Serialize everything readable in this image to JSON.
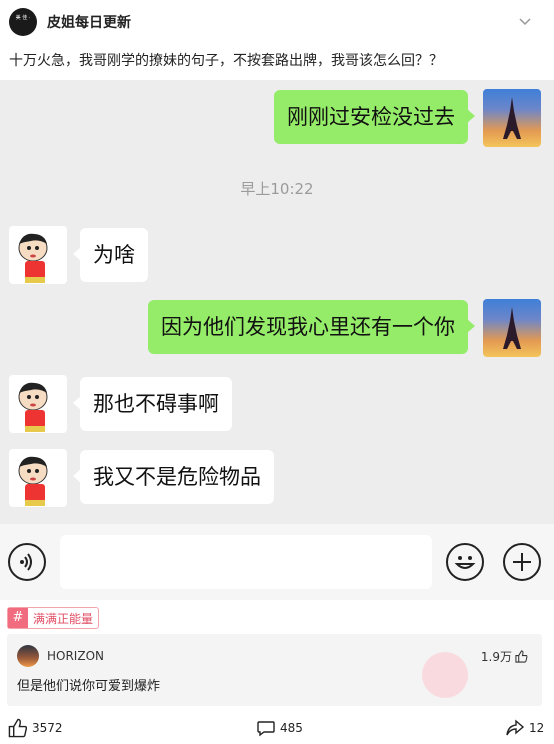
{
  "header": {
    "account_name": "皮姐每日更新",
    "logo_text": "美 佳 ·"
  },
  "post": {
    "question": "十万火急，我哥刚学的撩妹的句子，不按套路出牌，我哥该怎么回？？"
  },
  "chat": {
    "messages": [
      {
        "side": "sent",
        "text": "刚刚过安检没过去"
      },
      {
        "side": "recv",
        "text": "为啥"
      },
      {
        "side": "sent",
        "text": "因为他们发现我心里还有一个你"
      },
      {
        "side": "recv",
        "text": "那也不碍事啊"
      },
      {
        "side": "recv",
        "text": "我又不是危险物品"
      }
    ],
    "timestamp": "早上10:22"
  },
  "tag": {
    "label": "满满正能量"
  },
  "comment": {
    "user": "HORIZON",
    "likes": "1.9万",
    "text": "但是他们说你可爱到爆炸"
  },
  "actions": {
    "likes": "3572",
    "comments": "485",
    "shares": "12"
  },
  "colors": {
    "sent_bubble": "#95ec69",
    "chat_bg": "#ededed",
    "tag_accent": "#f06c7e"
  }
}
